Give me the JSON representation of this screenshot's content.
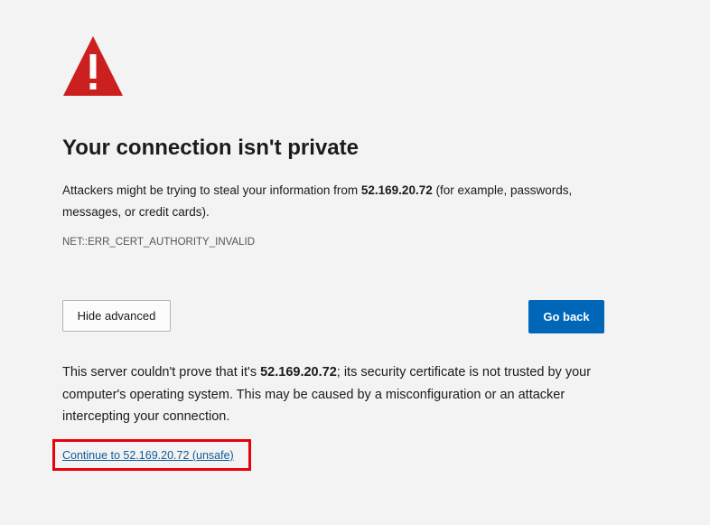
{
  "icon": {
    "name": "warning-icon",
    "color": "#cc1f1f"
  },
  "title": "Your connection isn't private",
  "description": {
    "before_host": "Attackers might be trying to steal your information from ",
    "host": "52.169.20.72",
    "after_host": " (for example, passwords, messages, or credit cards)."
  },
  "error_code": "NET::ERR_CERT_AUTHORITY_INVALID",
  "buttons": {
    "advanced_label": "Hide advanced",
    "go_back_label": "Go back",
    "go_back_color": "#0067b8"
  },
  "details": {
    "before_host": "This server couldn't prove that it's ",
    "host": "52.169.20.72",
    "after_host": "; its security certificate is not trusted by your computer's operating system. This may be caused by a misconfiguration or an attacker intercepting your connection."
  },
  "continue_link": "Continue to 52.169.20.72 (unsafe)",
  "highlight_color": "#e8000b"
}
